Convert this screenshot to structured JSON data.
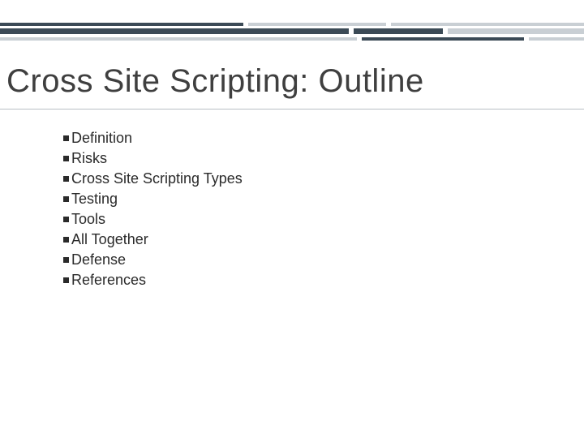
{
  "title": "Cross Site Scripting: Outline",
  "items": [
    "Definition",
    "Risks",
    "Cross Site Scripting Types",
    "Testing",
    "Tools",
    "All Together",
    "Defense",
    "References"
  ]
}
